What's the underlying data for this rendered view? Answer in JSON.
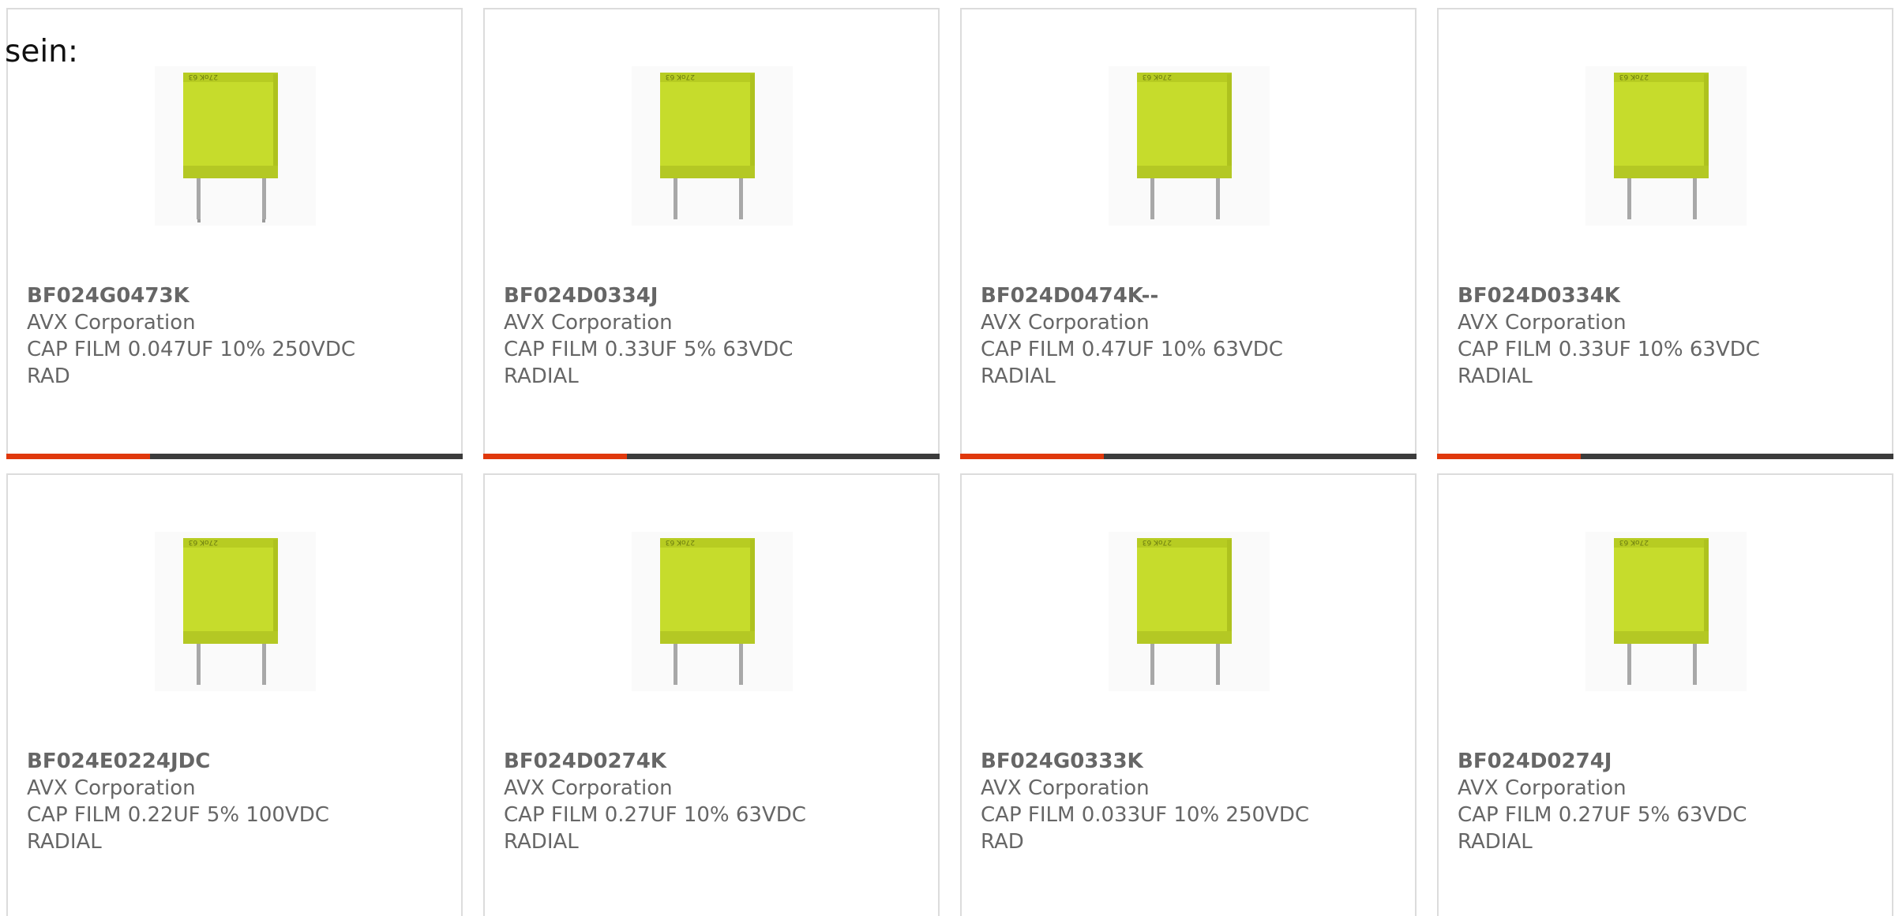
{
  "intro": {
    "text": "sein:"
  },
  "colors": {
    "accent": "#e0380c",
    "bar": "#3c3c3c",
    "capacitor_body": "#c6dc2c",
    "text": "#666666"
  },
  "products": [
    {
      "part_number": "BF024G0473K",
      "manufacturer": "AVX Corporation",
      "description_line1": "CAP FILM 0.047UF 10% 250VDC",
      "description_line2": "RAD",
      "image_icon": "film-capacitor-icon"
    },
    {
      "part_number": "BF024D0334J",
      "manufacturer": "AVX Corporation",
      "description_line1": "CAP FILM 0.33UF 5% 63VDC",
      "description_line2": "RADIAL",
      "image_icon": "film-capacitor-icon"
    },
    {
      "part_number": "BF024D0474K--",
      "manufacturer": "AVX Corporation",
      "description_line1": "CAP FILM 0.47UF 10% 63VDC",
      "description_line2": "RADIAL",
      "image_icon": "film-capacitor-icon"
    },
    {
      "part_number": "BF024D0334K",
      "manufacturer": "AVX Corporation",
      "description_line1": "CAP FILM 0.33UF 10% 63VDC",
      "description_line2": "RADIAL",
      "image_icon": "film-capacitor-icon"
    },
    {
      "part_number": "BF024E0224JDC",
      "manufacturer": "AVX Corporation",
      "description_line1": "CAP FILM 0.22UF 5% 100VDC",
      "description_line2": "RADIAL",
      "image_icon": "film-capacitor-icon"
    },
    {
      "part_number": "BF024D0274K",
      "manufacturer": "AVX Corporation",
      "description_line1": "CAP FILM 0.27UF 10% 63VDC",
      "description_line2": "RADIAL",
      "image_icon": "film-capacitor-icon"
    },
    {
      "part_number": "BF024G0333K",
      "manufacturer": "AVX Corporation",
      "description_line1": "CAP FILM 0.033UF 10% 250VDC",
      "description_line2": "RAD",
      "image_icon": "film-capacitor-icon"
    },
    {
      "part_number": "BF024D0274J",
      "manufacturer": "AVX Corporation",
      "description_line1": "CAP FILM 0.27UF 5% 63VDC",
      "description_line2": "RADIAL",
      "image_icon": "film-capacitor-icon"
    }
  ]
}
